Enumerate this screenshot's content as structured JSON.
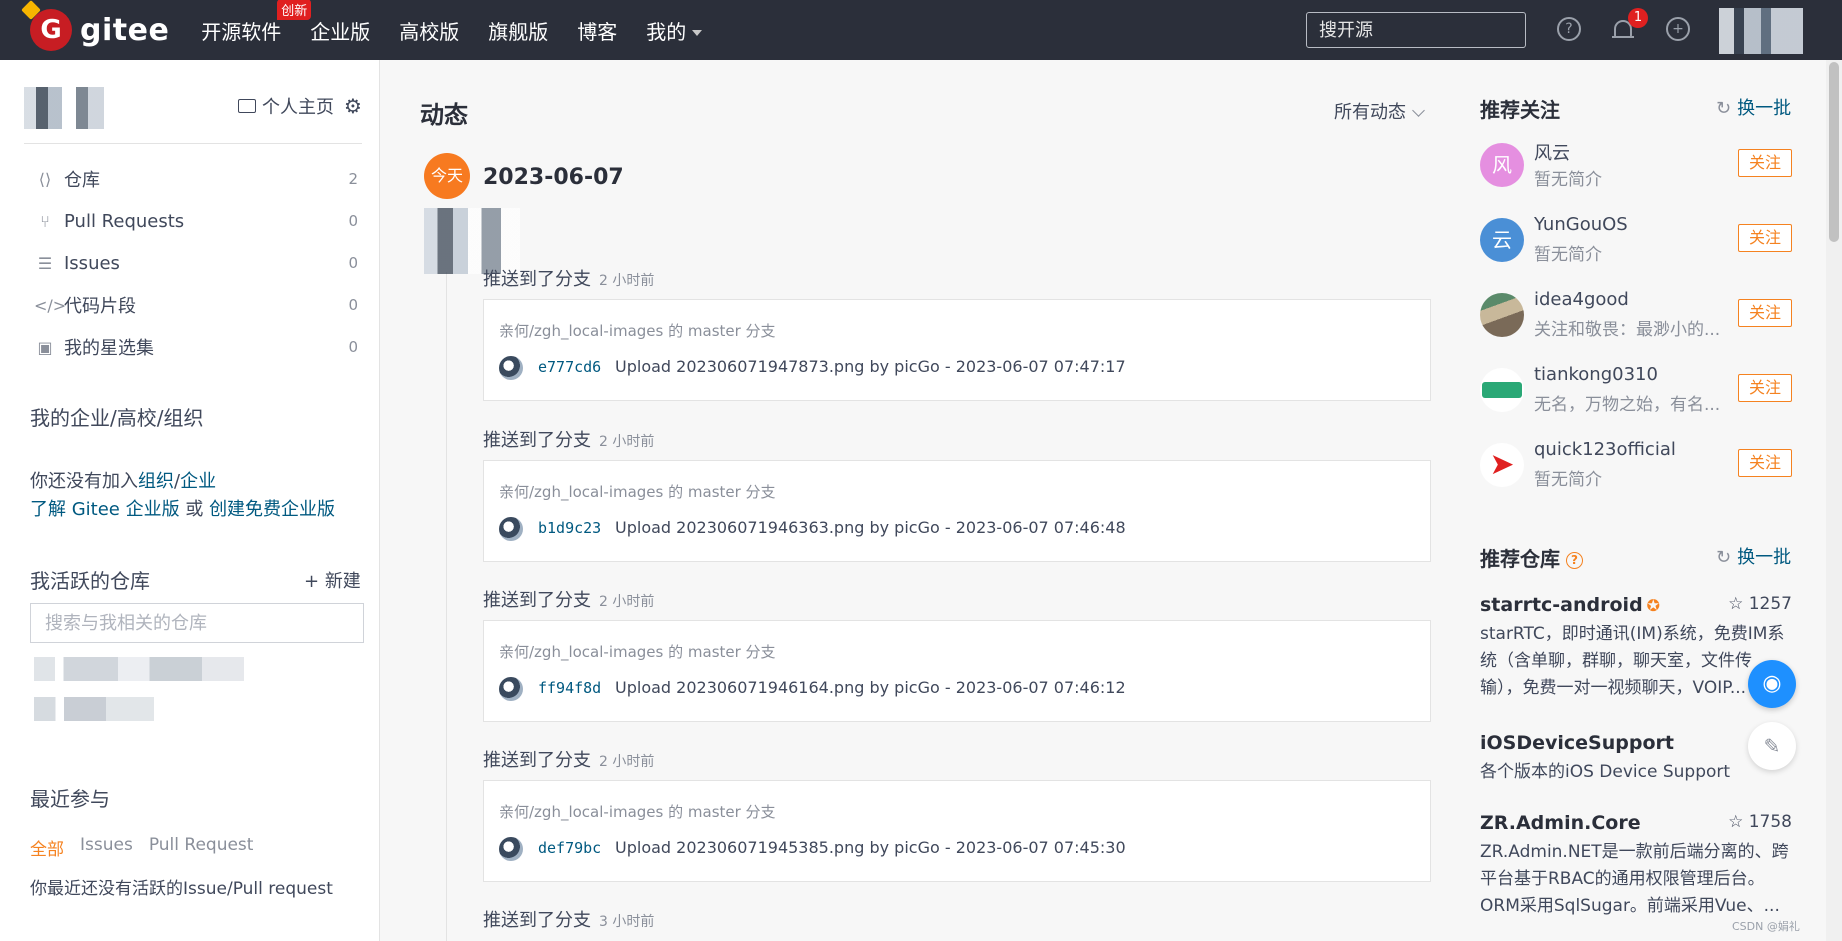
{
  "navbar": {
    "brand": "gitee",
    "items": [
      {
        "label": "开源软件",
        "badge": "创新"
      },
      {
        "label": "企业版"
      },
      {
        "label": "高校版"
      },
      {
        "label": "旗舰版"
      },
      {
        "label": "博客"
      },
      {
        "label": "我的"
      }
    ],
    "search_placeholder": "搜开源",
    "notification_count": "1"
  },
  "sidebar": {
    "home_link": "个人主页",
    "menu": [
      {
        "label": "仓库",
        "count": "2",
        "icon": "code-icon"
      },
      {
        "label": "Pull Requests",
        "count": "0",
        "icon": "pull-request-icon"
      },
      {
        "label": "Issues",
        "count": "0",
        "icon": "issues-icon"
      },
      {
        "label": "代码片段",
        "count": "0",
        "icon": "snippet-icon"
      },
      {
        "label": "我的星选集",
        "count": "0",
        "icon": "collection-icon"
      }
    ],
    "org_title": "我的企业/高校/组织",
    "org_line1_prefix": "你还没有加入",
    "org_link_org": "组织",
    "org_link_sep": "/",
    "org_link_ent": "企业",
    "org_line2_link1": "了解 Gitee 企业版",
    "org_line2_or": " 或 ",
    "org_line2_link2": "创建免费企业版",
    "active_repos_title": "我活跃的仓库",
    "new_label": "新建",
    "repo_search_placeholder": "搜索与我相关的仓库",
    "recent_title": "最近参与",
    "recent_tabs": [
      "全部",
      "Issues",
      "Pull Request"
    ],
    "recent_empty": "你最近还没有活跃的Issue/Pull request"
  },
  "feed": {
    "title": "动态",
    "filter": "所有动态",
    "today_badge": "今天",
    "date": "2023-06-07",
    "events": [
      {
        "action": "推送到了分支",
        "ago": "2 小时前",
        "repo": "亲何/zgh_local-images 的 master 分支",
        "sha": "e777cd6",
        "message": "Upload 202306071947873.png by picGo - 2023-06-07 07:47:17"
      },
      {
        "action": "推送到了分支",
        "ago": "2 小时前",
        "repo": "亲何/zgh_local-images 的 master 分支",
        "sha": "b1d9c23",
        "message": "Upload 202306071946363.png by picGo - 2023-06-07 07:46:48"
      },
      {
        "action": "推送到了分支",
        "ago": "2 小时前",
        "repo": "亲何/zgh_local-images 的 master 分支",
        "sha": "ff94f8d",
        "message": "Upload 202306071946164.png by picGo - 2023-06-07 07:46:12"
      },
      {
        "action": "推送到了分支",
        "ago": "2 小时前",
        "repo": "亲何/zgh_local-images 的 master 分支",
        "sha": "def79bc",
        "message": "Upload 202306071945385.png by picGo - 2023-06-07 07:45:30"
      },
      {
        "action": "推送到了分支",
        "ago": "3 小时前"
      }
    ]
  },
  "recommend_users": {
    "title": "推荐关注",
    "refresh": "换一批",
    "follow_label": "关注",
    "users": [
      {
        "name": "风云",
        "desc": "暂无简介",
        "avatar_text": "风",
        "color": "#e58fe0"
      },
      {
        "name": "YunGouOS",
        "desc": "暂无简介",
        "avatar_text": "云",
        "color": "#4a8fd6"
      },
      {
        "name": "idea4good",
        "desc": "关注和敬畏：最渺小的...",
        "avatar_text": "",
        "color": "#7a6a58"
      },
      {
        "name": "tiankong0310",
        "desc": "无名，万物之始，有名...",
        "avatar_text": "",
        "color": "#2aa876"
      },
      {
        "name": "quick123official",
        "desc": "暂无简介",
        "avatar_text": "",
        "color": "#e02020"
      }
    ]
  },
  "recommend_repos": {
    "title": "推荐仓库",
    "refresh": "换一批",
    "repos": [
      {
        "name": "starrtc-android",
        "stars": "1257",
        "desc": "starRTC，即时通讯(IM)系统，免费IM系统（含单聊，群聊，聊天室，文件传输），免费一对一视频聊天，VOIP..."
      },
      {
        "name": "iOSDeviceSupport",
        "stars": "",
        "desc": "各个版本的iOS Device Support"
      },
      {
        "name": "ZR.Admin.Core",
        "stars": "1758",
        "desc": "ZR.Admin.NET是一款前后端分离的、跨平台基于RBAC的通用权限管理后台。ORM采用SqlSugar。前端采用Vue、..."
      }
    ]
  },
  "watermark": "CSDN @娟礼"
}
